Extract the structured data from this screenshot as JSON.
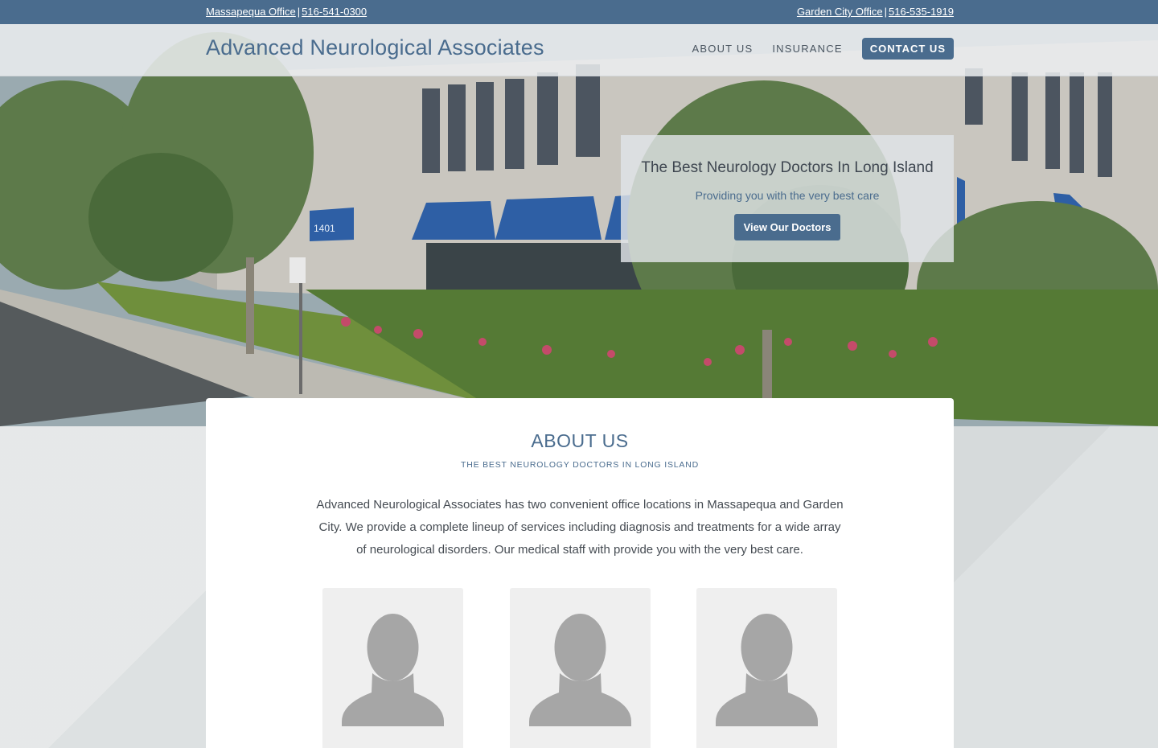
{
  "topbar": {
    "left_office": "Massapequa Office",
    "left_sep": "|",
    "left_phone": "516-541-0300",
    "right_office": "Garden City Office",
    "right_sep": "|",
    "right_phone": "516-535-1919"
  },
  "header": {
    "brand": "Advanced Neurological Associates",
    "nav": {
      "about": "ABOUT US",
      "insurance": "INSURANCE",
      "contact": "CONTACT US"
    }
  },
  "hero": {
    "title": "The Best Neurology Doctors In Long Island",
    "subtitle": "Providing you with the very best care",
    "button": "View Our Doctors",
    "building_number": "1401"
  },
  "about": {
    "title": "ABOUT US",
    "subtitle": "THE BEST NEUROLOGY DOCTORS IN LONG ISLAND",
    "body": "Advanced Neurological Associates has two convenient office locations in Massapequa and Garden City. We provide a complete lineup of services including diagnosis and treatments for a wide array of neurological disorders. Our medical staff with provide you with the very best care.",
    "doctor_cards": [
      {
        "icon": "person-placeholder-icon"
      },
      {
        "icon": "person-placeholder-icon"
      },
      {
        "icon": "person-placeholder-icon"
      }
    ]
  },
  "colors": {
    "brand": "#4a6c8e",
    "text": "#454b52",
    "card_bg": "#efefef",
    "avatar": "#a6a6a6"
  }
}
